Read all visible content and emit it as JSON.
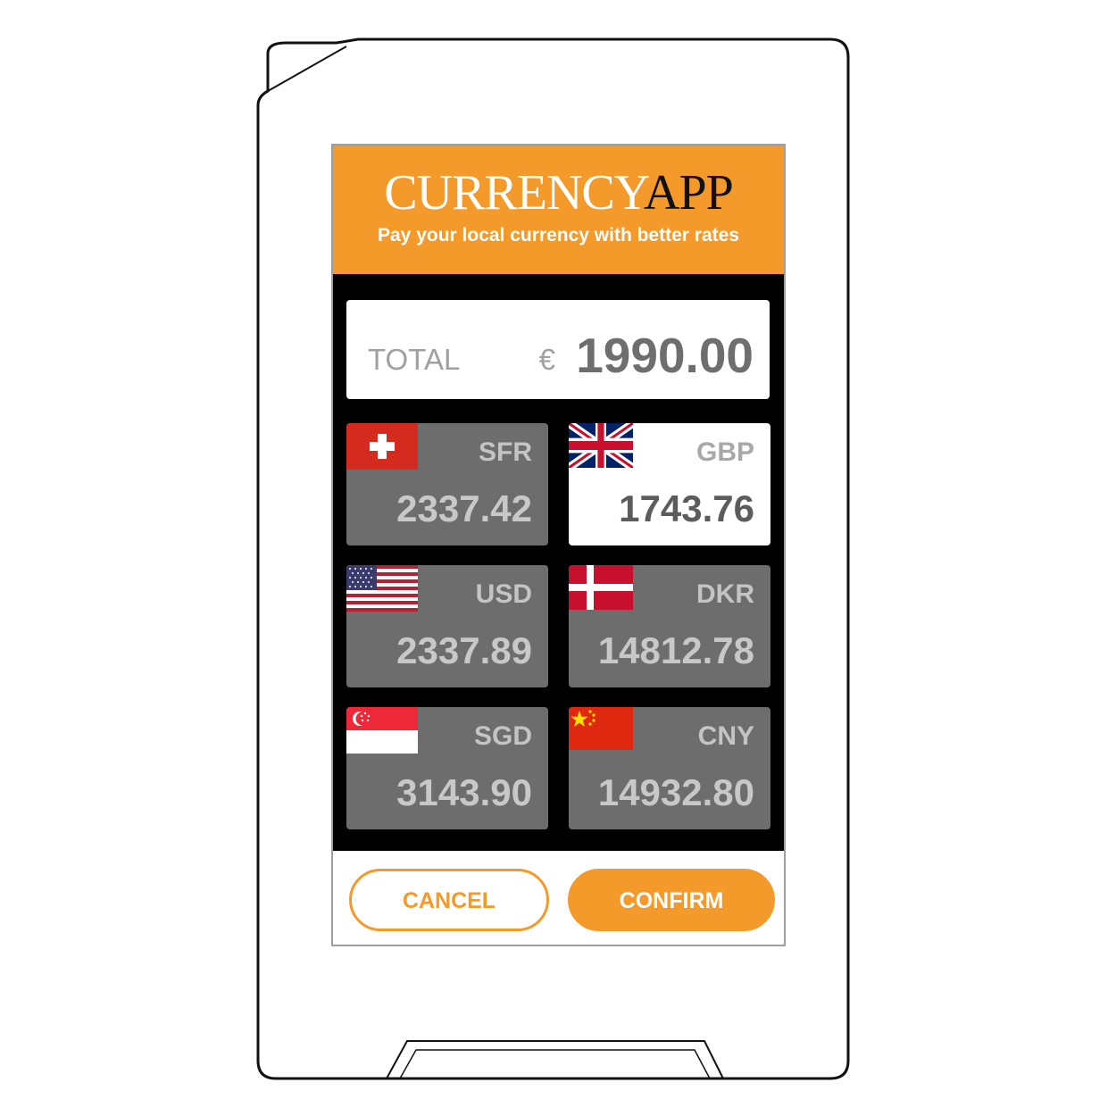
{
  "app": {
    "title_part1": "CURRENCY",
    "title_part2": "APP",
    "tagline": "Pay your local currency with better rates"
  },
  "total": {
    "label": "TOTAL",
    "symbol": "€",
    "amount": "1990.00"
  },
  "currencies": [
    {
      "code": "SFR",
      "amount": "2337.42",
      "flag": "swiss-flag-icon",
      "selected": false
    },
    {
      "code": "GBP",
      "amount": "1743.76",
      "flag": "uk-flag-icon",
      "selected": true
    },
    {
      "code": "USD",
      "amount": "2337.89",
      "flag": "us-flag-icon",
      "selected": false
    },
    {
      "code": "DKR",
      "amount": "14812.78",
      "flag": "denmark-flag-icon",
      "selected": false
    },
    {
      "code": "SGD",
      "amount": "3143.90",
      "flag": "singapore-flag-icon",
      "selected": false
    },
    {
      "code": "CNY",
      "amount": "14932.80",
      "flag": "china-flag-icon",
      "selected": false
    }
  ],
  "actions": {
    "cancel": "CANCEL",
    "confirm": "CONFIRM"
  },
  "colors": {
    "accent": "#f39a2b",
    "tile": "#6d6d6d",
    "selected_tile": "#ffffff",
    "screen_background": "#000000"
  }
}
